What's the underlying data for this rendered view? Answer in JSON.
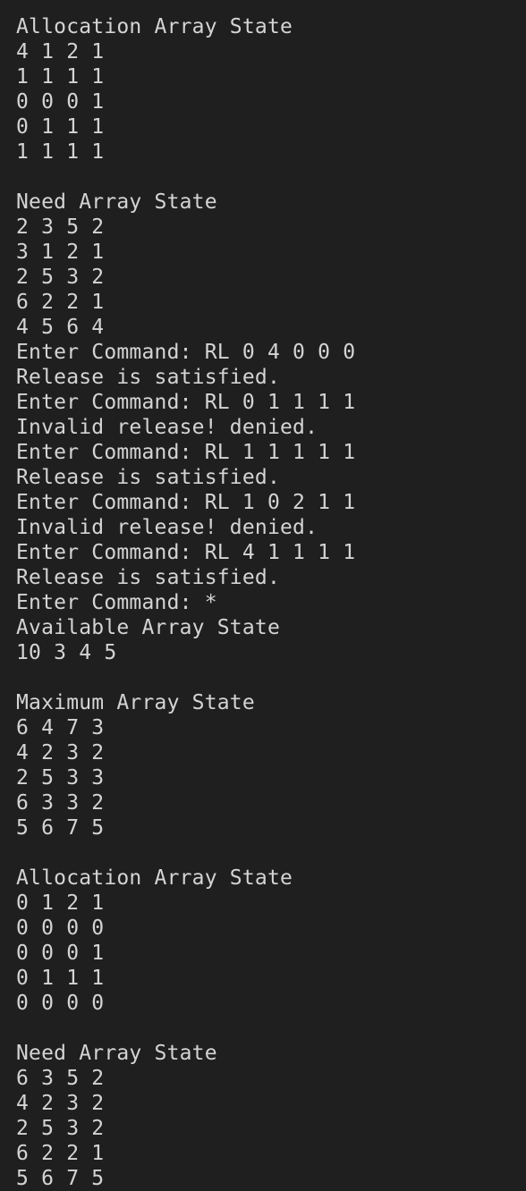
{
  "theme": {
    "background": "#1f1f1f",
    "foreground": "#d4d4d4"
  },
  "terminal": {
    "lines": [
      "Allocation Array State",
      "4 1 2 1",
      "1 1 1 1",
      "0 0 0 1",
      "0 1 1 1",
      "1 1 1 1",
      "",
      "Need Array State",
      "2 3 5 2",
      "3 1 2 1",
      "2 5 3 2",
      "6 2 2 1",
      "4 5 6 4",
      "Enter Command: RL 0 4 0 0 0",
      "Release is satisfied.",
      "Enter Command: RL 0 1 1 1 1",
      "Invalid release! denied.",
      "Enter Command: RL 1 1 1 1 1",
      "Release is satisfied.",
      "Enter Command: RL 1 0 2 1 1",
      "Invalid release! denied.",
      "Enter Command: RL 4 1 1 1 1",
      "Release is satisfied.",
      "Enter Command: *",
      "Available Array State",
      "10 3 4 5",
      "",
      "Maximum Array State",
      "6 4 7 3",
      "4 2 3 2",
      "2 5 3 3",
      "6 3 3 2",
      "5 6 7 5",
      "",
      "Allocation Array State",
      "0 1 2 1",
      "0 0 0 0",
      "0 0 0 1",
      "0 1 1 1",
      "0 0 0 0",
      "",
      "Need Array State",
      "6 3 5 2",
      "4 2 3 2",
      "2 5 3 2",
      "6 2 2 1",
      "5 6 7 5"
    ]
  }
}
